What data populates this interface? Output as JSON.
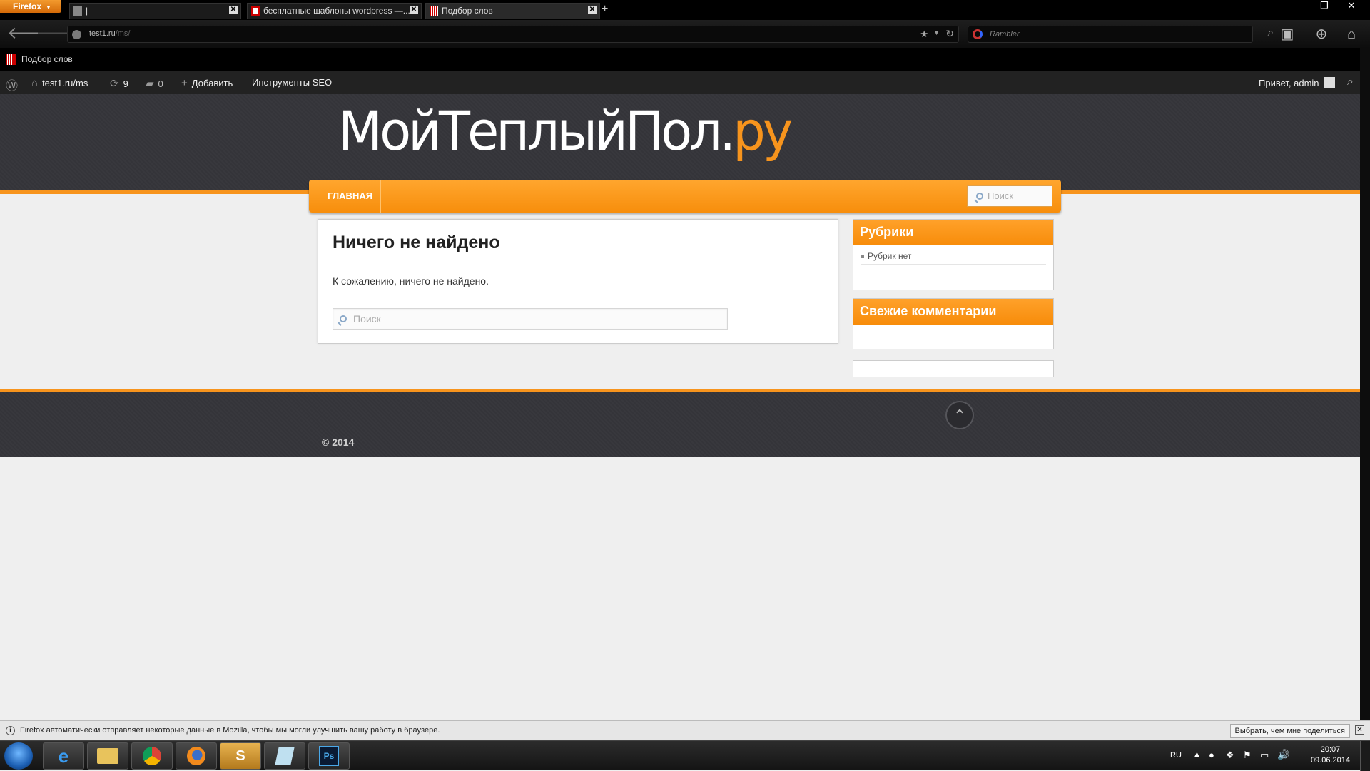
{
  "browser": {
    "menu_button": "Firefox",
    "tabs": [
      {
        "title": "|"
      },
      {
        "title": "бесплатные шаблоны wordpress —..."
      },
      {
        "title": "Подбор слов"
      }
    ],
    "new_tab": "+",
    "window_controls": {
      "minimize": "–",
      "restore": "❐",
      "close": "✕"
    },
    "url_host": "test1.ru",
    "url_path": "/ms/",
    "search_placeholder": "Rambler",
    "bookmark": "Подбор слов"
  },
  "adminbar": {
    "site_name": "test1.ru/ms",
    "updates_count": "9",
    "comments_count": "0",
    "add_new": "Добавить",
    "seo_tools": "Инструменты SEO",
    "greeting": "Привет, admin"
  },
  "site": {
    "logo_main": "МойТеплыйПол.",
    "logo_accent": "ру",
    "menu_home": "ГЛАВНАЯ",
    "menu_search_placeholder": "Поиск",
    "not_found_title": "Ничего не найдено",
    "not_found_text": "К сожалению, ничего не найдено.",
    "content_search_placeholder": "Поиск",
    "widgets": {
      "categories_title": "Рубрики",
      "categories_empty": "Рубрик нет",
      "comments_title": "Свежие комментарии"
    },
    "copyright": "© 2014",
    "accent_color": "#f7941d"
  },
  "notice": {
    "message": "Firefox автоматически отправляет некоторые данные в Mozilla, чтобы мы могли улучшить вашу работу в браузере.",
    "button": "Выбрать, чем мне поделиться"
  },
  "taskbar": {
    "lang": "RU",
    "time": "20:07",
    "date": "09.06.2014",
    "apps": [
      "start-orb",
      "internet-explorer",
      "file-explorer",
      "chrome",
      "firefox",
      "skype",
      "notepad",
      "photoshop"
    ]
  }
}
